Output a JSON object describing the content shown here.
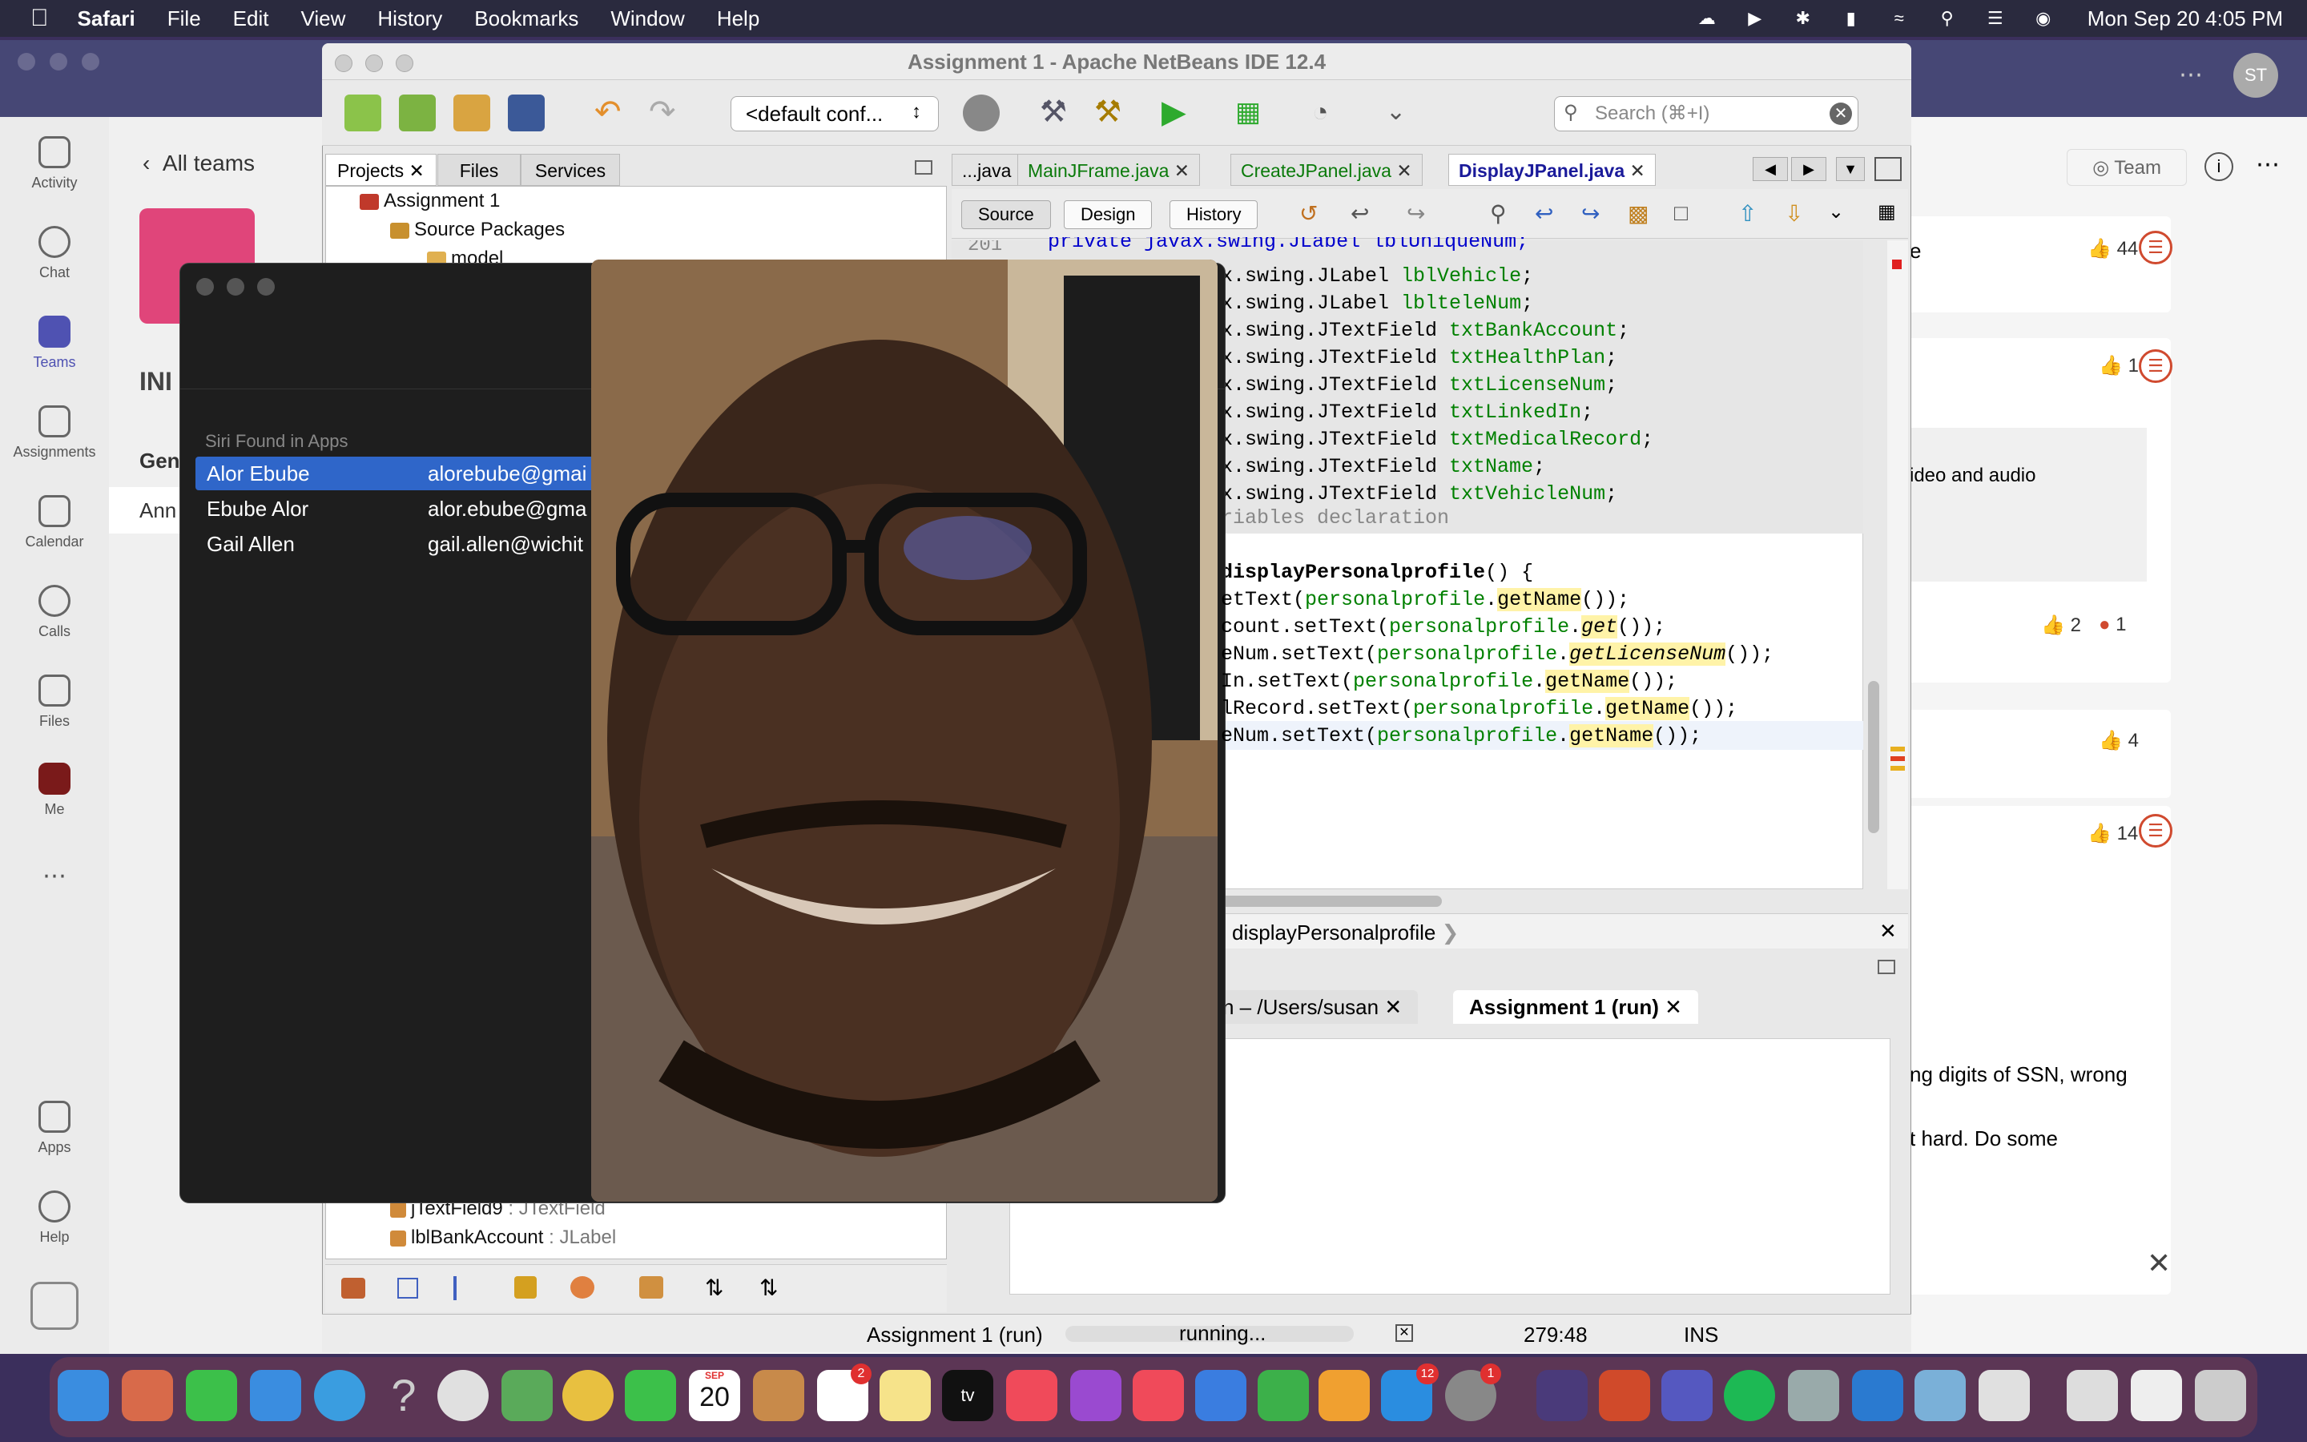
{
  "menubar": {
    "app": "Safari",
    "items": [
      "File",
      "Edit",
      "View",
      "History",
      "Bookmarks",
      "Window",
      "Help"
    ],
    "clock": "Mon Sep 20  4:05 PM"
  },
  "teams": {
    "rail": [
      "Activity",
      "Chat",
      "Teams",
      "Assignments",
      "Calendar",
      "Calls",
      "Files",
      "Me",
      "Apps",
      "Help"
    ],
    "back_label": "All teams",
    "team_initials": "INI",
    "channel_general": "Gen",
    "channel_ann": "Ann",
    "team_label": "Team",
    "avatar_initials": "ST",
    "reactions": [
      "44",
      "1",
      "2",
      "1",
      "4",
      "14"
    ],
    "snippets": [
      "e",
      "ideo and audio",
      "ng digits of SSN, wrong",
      "t hard. Do some"
    ]
  },
  "netbeans": {
    "title": "Assignment 1 - Apache NetBeans IDE 12.4",
    "config": "<default conf...",
    "search_placeholder": "Search (⌘+I)",
    "panel_tabs": [
      "Projects",
      "Files",
      "Services"
    ],
    "tree": {
      "project": "Assignment 1",
      "source": "Source Packages",
      "model": "model",
      "field9": "jTextField9",
      "field9_type": " : JTextField",
      "bank": "lblBankAccount",
      "bank_type": " : JLabel"
    },
    "editor_tabs": [
      "...java",
      "MainJFrame.java",
      "CreateJPanel.java",
      "DisplayJPanel.java"
    ],
    "editor_buttons": [
      "Source",
      "Design",
      "History"
    ],
    "code": {
      "line_no": "201",
      "l0": "    private javax.swing.JLabel lblUniqueNum;",
      "fields": [
        [
          "x.swing.JLabel ",
          "lblVehicle",
          ";"
        ],
        [
          "x.swing.JLabel ",
          "lblteleNum",
          ";"
        ],
        [
          "x.swing.JTextField ",
          "txtBankAccount",
          ";"
        ],
        [
          "x.swing.JTextField ",
          "txtHealthPlan",
          ";"
        ],
        [
          "x.swing.JTextField ",
          "txtLicenseNum",
          ";"
        ],
        [
          "x.swing.JTextField ",
          "txtLinkedIn",
          ";"
        ],
        [
          "x.swing.JTextField ",
          "txtMedicalRecord",
          ";"
        ],
        [
          "x.swing.JTextField ",
          "txtName",
          ";"
        ],
        [
          "x.swing.JTextField ",
          "txtVehicleNum",
          ";"
        ]
      ],
      "comment": "riables declaration",
      "method": "displayPersonalprofile",
      "method_tail": "() {",
      "calls": [
        [
          "etText(",
          "personalprofile",
          ".",
          "getName",
          "());"
        ],
        [
          "count.setText(",
          "personalprofile",
          ".",
          "get",
          "());"
        ],
        [
          "eNum.setText(",
          "personalprofile",
          ".",
          "getLicenseNum",
          "());"
        ],
        [
          "In.setText(",
          "personalprofile",
          ".",
          "getName",
          "());"
        ],
        [
          "lRecord.setText(",
          "personalprofile",
          ".",
          "getName",
          "());"
        ],
        [
          "eNum.setText(",
          "personalprofile",
          ".",
          "getName",
          "());"
        ]
      ]
    },
    "nav_label": "displayPersonalprofile",
    "output_tab1": "n – /Users/susan",
    "output_tab2": "Assignment 1 (run)",
    "status": {
      "task": "Assignment 1 (run)",
      "state": "running...",
      "position": "279:48",
      "mode": "INS"
    }
  },
  "siri": {
    "header": "Siri Found in Apps",
    "contacts": [
      {
        "name": "Alor Ebube",
        "email": "alorebube@gmai"
      },
      {
        "name": "Ebube Alor",
        "email": "alor.ebube@gma"
      },
      {
        "name": "Gail Allen",
        "email": "gail.allen@wichit"
      }
    ]
  },
  "dock": {
    "calendar_month": "SEP",
    "calendar_day": "20",
    "badges": [
      "2",
      "12",
      "1"
    ]
  }
}
